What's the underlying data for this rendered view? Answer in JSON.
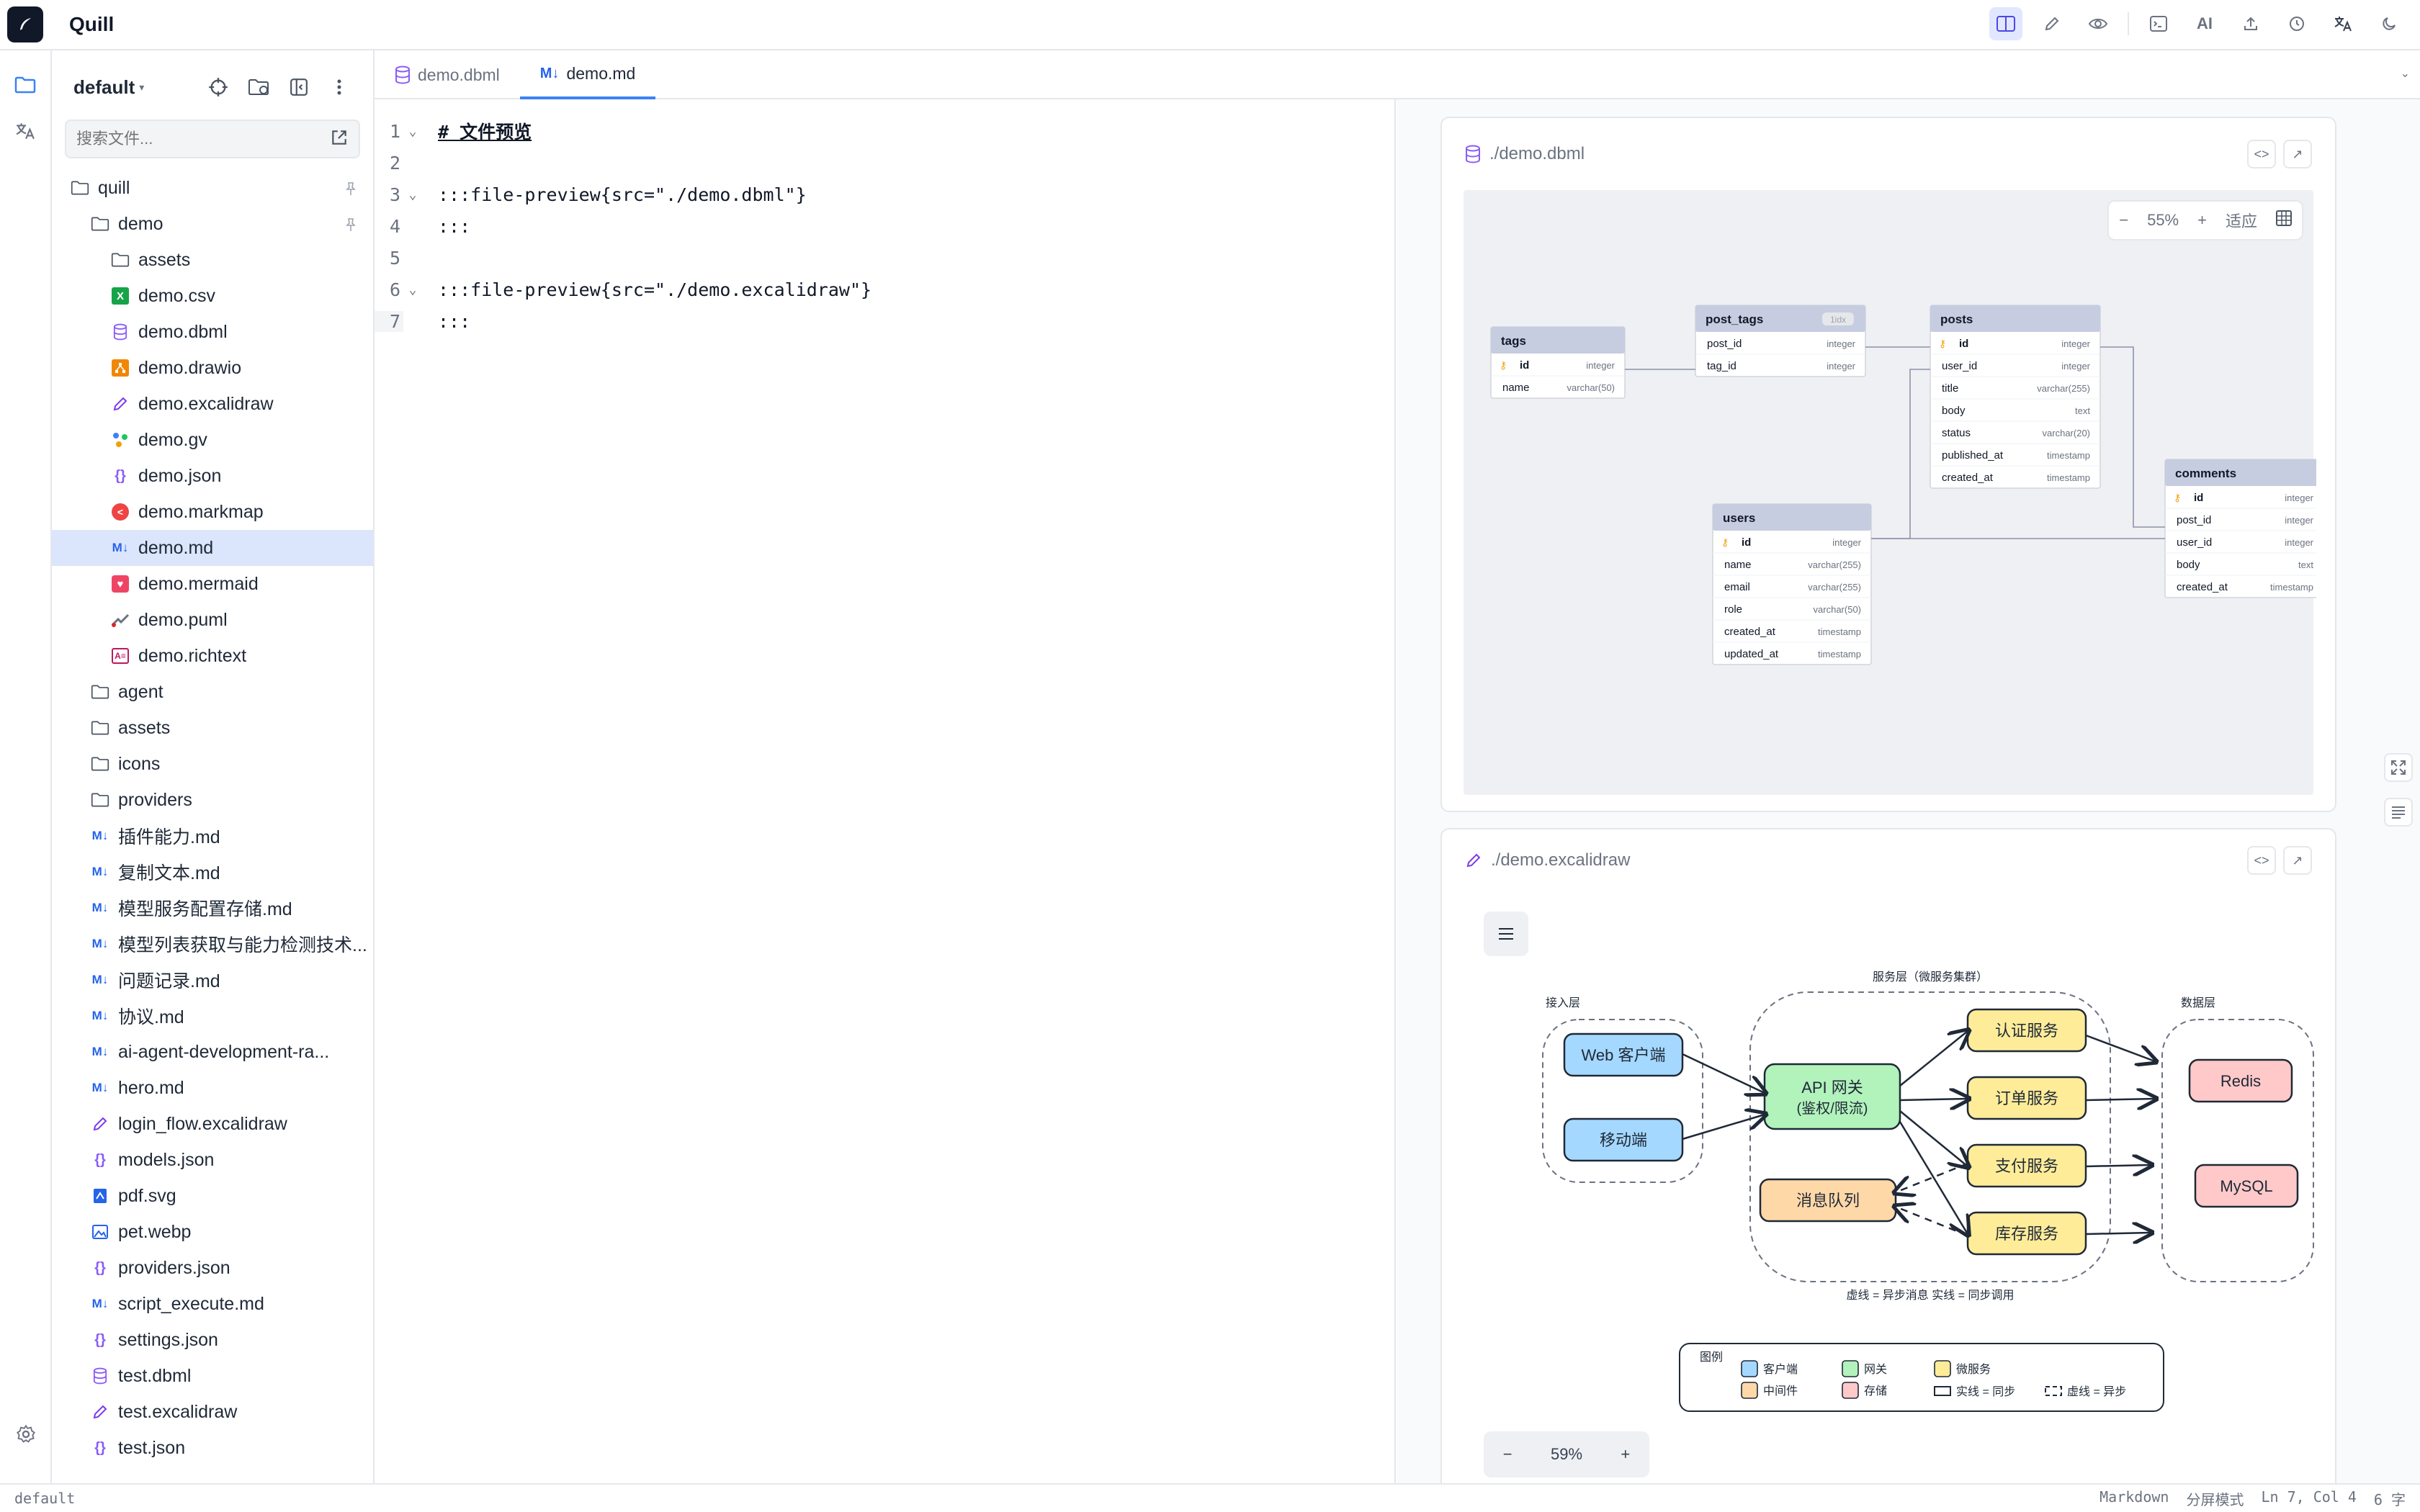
{
  "app": {
    "name": "Quill"
  },
  "sidebar": {
    "workspace": "default",
    "search_placeholder": "搜索文件...",
    "tree": [
      {
        "label": "quill",
        "type": "folder",
        "depth": 0,
        "pin": true
      },
      {
        "label": "demo",
        "type": "folder",
        "depth": 1,
        "pin": true
      },
      {
        "label": "assets",
        "type": "folder",
        "depth": 2
      },
      {
        "label": "demo.csv",
        "type": "csv",
        "depth": 2
      },
      {
        "label": "demo.dbml",
        "type": "dbml",
        "depth": 2
      },
      {
        "label": "demo.drawio",
        "type": "drawio",
        "depth": 2
      },
      {
        "label": "demo.excalidraw",
        "type": "excalidraw",
        "depth": 2
      },
      {
        "label": "demo.gv",
        "type": "gv",
        "depth": 2
      },
      {
        "label": "demo.json",
        "type": "json",
        "depth": 2
      },
      {
        "label": "demo.markmap",
        "type": "markmap",
        "depth": 2
      },
      {
        "label": "demo.md",
        "type": "md",
        "depth": 2,
        "selected": true
      },
      {
        "label": "demo.mermaid",
        "type": "mermaid",
        "depth": 2
      },
      {
        "label": "demo.puml",
        "type": "puml",
        "depth": 2
      },
      {
        "label": "demo.richtext",
        "type": "richtext",
        "depth": 2
      },
      {
        "label": "agent",
        "type": "folder",
        "depth": 1
      },
      {
        "label": "assets",
        "type": "folder",
        "depth": 1
      },
      {
        "label": "icons",
        "type": "folder",
        "depth": 1
      },
      {
        "label": "providers",
        "type": "folder",
        "depth": 1
      },
      {
        "label": "插件能力.md",
        "type": "md",
        "depth": 1
      },
      {
        "label": "复制文本.md",
        "type": "md",
        "depth": 1
      },
      {
        "label": "模型服务配置存储.md",
        "type": "md",
        "depth": 1
      },
      {
        "label": "模型列表获取与能力检测技术...",
        "type": "md",
        "depth": 1
      },
      {
        "label": "问题记录.md",
        "type": "md",
        "depth": 1
      },
      {
        "label": "协议.md",
        "type": "md",
        "depth": 1
      },
      {
        "label": "ai-agent-development-ra...",
        "type": "md",
        "depth": 1
      },
      {
        "label": "hero.md",
        "type": "md",
        "depth": 1
      },
      {
        "label": "login_flow.excalidraw",
        "type": "excalidraw",
        "depth": 1
      },
      {
        "label": "models.json",
        "type": "json",
        "depth": 1
      },
      {
        "label": "pdf.svg",
        "type": "svg",
        "depth": 1
      },
      {
        "label": "pet.webp",
        "type": "image",
        "depth": 1
      },
      {
        "label": "providers.json",
        "type": "json",
        "depth": 1
      },
      {
        "label": "script_execute.md",
        "type": "md",
        "depth": 1
      },
      {
        "label": "settings.json",
        "type": "json",
        "depth": 1
      },
      {
        "label": "test.dbml",
        "type": "dbml",
        "depth": 1
      },
      {
        "label": "test.excalidraw",
        "type": "excalidraw",
        "depth": 1
      },
      {
        "label": "test.json",
        "type": "json",
        "depth": 1
      }
    ]
  },
  "tabs": [
    {
      "label": "demo.dbml",
      "icon": "database-icon",
      "active": false
    },
    {
      "label": "demo.md",
      "icon": "markdown-icon",
      "active": true
    }
  ],
  "editor": {
    "lines": [
      {
        "n": "1",
        "text": "# 文件预览",
        "fold": true,
        "heading": true
      },
      {
        "n": "2",
        "text": "",
        "fold": false
      },
      {
        "n": "3",
        "text": ":::file-preview{src=\"./demo.dbml\"}",
        "fold": true
      },
      {
        "n": "4",
        "text": ":::",
        "fold": false
      },
      {
        "n": "5",
        "text": "",
        "fold": false
      },
      {
        "n": "6",
        "text": ":::file-preview{src=\"./demo.excalidraw\"}",
        "fold": true
      },
      {
        "n": "7",
        "text": ":::",
        "fold": false,
        "current": true
      }
    ]
  },
  "preview": {
    "dbml": {
      "path": "./demo.dbml",
      "zoom": "55%",
      "fit_label": "适应",
      "tables": [
        {
          "name": "tags",
          "cols": [
            [
              "id",
              "integer",
              true
            ],
            [
              "name",
              "varchar(50)",
              false
            ]
          ]
        },
        {
          "name": "post_tags",
          "badge": "1idx",
          "cols": [
            [
              "post_id",
              "integer",
              false
            ],
            [
              "tag_id",
              "integer",
              false
            ]
          ]
        },
        {
          "name": "posts",
          "cols": [
            [
              "id",
              "integer",
              true
            ],
            [
              "user_id",
              "integer",
              false
            ],
            [
              "title",
              "varchar(255)",
              false
            ],
            [
              "body",
              "text",
              false
            ],
            [
              "status",
              "varchar(20)",
              false
            ],
            [
              "published_at",
              "timestamp",
              false
            ],
            [
              "created_at",
              "timestamp",
              false
            ]
          ]
        },
        {
          "name": "users",
          "cols": [
            [
              "id",
              "integer",
              true
            ],
            [
              "name",
              "varchar(255)",
              false
            ],
            [
              "email",
              "varchar(255)",
              false
            ],
            [
              "role",
              "varchar(50)",
              false
            ],
            [
              "created_at",
              "timestamp",
              false
            ],
            [
              "updated_at",
              "timestamp",
              false
            ]
          ]
        },
        {
          "name": "comments",
          "cols": [
            [
              "id",
              "integer",
              true
            ],
            [
              "post_id",
              "integer",
              false
            ],
            [
              "user_id",
              "integer",
              false
            ],
            [
              "body",
              "text",
              false
            ],
            [
              "created_at",
              "timestamp",
              false
            ]
          ]
        }
      ]
    },
    "excalidraw": {
      "path": "./demo.excalidraw",
      "zoom": "59%",
      "groups": {
        "access": "接入层",
        "service": "服务层（微服务集群）",
        "data": "数据层"
      },
      "nodes": {
        "web": "Web 客户端",
        "mobile": "移动端",
        "gateway1": "API 网关",
        "gateway2": "(鉴权/限流)",
        "auth": "认证服务",
        "order": "订单服务",
        "pay": "支付服务",
        "stock": "库存服务",
        "mq": "消息队列",
        "redis": "Redis",
        "mysql": "MySQL"
      },
      "note": "虚线 = 异步消息  实线 = 同步调用",
      "legend": {
        "title": "图例",
        "client": "客户端",
        "gateway": "网关",
        "micro": "微服务",
        "middleware": "中间件",
        "storage": "存储",
        "solid": "实线 = 同步",
        "dashed": "虚线 = 异步"
      }
    }
  },
  "status": {
    "left": "default",
    "mode": "Markdown",
    "layout": "分屏模式",
    "position": "Ln 7, Col 4",
    "words": "6 字"
  },
  "colors": {
    "accent": "#3b82f6",
    "client": "#a5d8ff",
    "gateway": "#b2f2bb",
    "service": "#ffec99",
    "middleware": "#ffd8a8",
    "storage": "#ffc9c9"
  }
}
